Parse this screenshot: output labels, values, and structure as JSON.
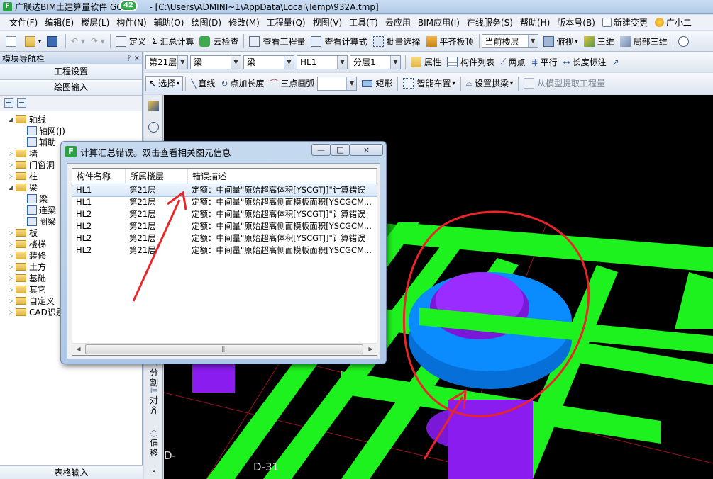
{
  "window": {
    "app_logo": "F",
    "title": "广联达BIM土建算量软件 GC",
    "path": " - [C:\\Users\\ADMINI~1\\AppData\\Local\\Temp\\932A.tmp]",
    "badge": "42"
  },
  "menu": [
    "文件(F)",
    "编辑(E)",
    "楼层(L)",
    "构件(N)",
    "辅助(O)",
    "绘图(D)",
    "修改(M)",
    "工程量(Q)",
    "视图(V)",
    "工具(T)",
    "云应用",
    "BIM应用(I)",
    "在线服务(S)",
    "帮助(H)",
    "版本号(B)"
  ],
  "menu_right": [
    "新建变更",
    "广小二"
  ],
  "toolbar1": {
    "define": "定义",
    "sum_calc": "汇总计算",
    "cloud_check": "云检查",
    "view_quantity": "查看工程量",
    "view_formula": "查看计算式",
    "batch_select": "批量选择",
    "align_slab": "平齐板顶",
    "floor_combo": "当前楼层",
    "top_view": "俯视",
    "three_d": "三维",
    "local_3d": "局部三维"
  },
  "toolbar2": {
    "floor": "第21层",
    "category": "梁",
    "type": "梁",
    "component": "HL1",
    "sublayer": "分层1",
    "properties": "属性",
    "component_list": "构件列表",
    "two_points": "两点",
    "parallel": "平行",
    "length_mark": "长度标注"
  },
  "toolbar3": {
    "select": "选择",
    "line": "直线",
    "point_length": "点加长度",
    "arc": "三点画弧",
    "rect": "矩形",
    "smart_place": "智能布置",
    "set_arch": "设置拱梁",
    "extract": "从模型提取工程量"
  },
  "nav": {
    "header": "模块导航栏",
    "pin": "ᚹ ×",
    "project_settings": "工程设置",
    "draw_input": "绘图输入",
    "table_input": "表格输入",
    "tree": [
      {
        "label": "轴线",
        "level": 0,
        "expanded": true
      },
      {
        "label": "轴网(J)",
        "level": 1
      },
      {
        "label": "辅助",
        "level": 1
      },
      {
        "label": "墙",
        "level": 0
      },
      {
        "label": "门窗洞",
        "level": 0
      },
      {
        "label": "柱",
        "level": 0
      },
      {
        "label": "梁",
        "level": 0,
        "expanded": true
      },
      {
        "label": "梁",
        "level": 1
      },
      {
        "label": "连梁",
        "level": 1
      },
      {
        "label": "圈梁",
        "level": 1
      },
      {
        "label": "板",
        "level": 0
      },
      {
        "label": "楼梯",
        "level": 0
      },
      {
        "label": "装修",
        "level": 0
      },
      {
        "label": "土方",
        "level": 0
      },
      {
        "label": "基础",
        "level": 0
      },
      {
        "label": "其它",
        "level": 0
      },
      {
        "label": "自定义",
        "level": 0
      },
      {
        "label": "CAD识别",
        "level": 0
      }
    ]
  },
  "side_tools": {
    "split": "分割",
    "split_prefix": "刂",
    "align": "对齐",
    "offset": "偏移"
  },
  "viewport": {
    "label_main": "D-31",
    "label_left": "D-"
  },
  "dialog": {
    "title": "计算汇总错误。双击查看相关图元信息",
    "min": "—",
    "max": "□",
    "close": "×",
    "columns": [
      "构件名称",
      "所属楼层",
      "错误描述"
    ],
    "rows": [
      {
        "name": "HL1",
        "floor": "第21层",
        "desc": "定额：中间量\"原始超高体积[YSCGTJ]\"计算错误"
      },
      {
        "name": "HL1",
        "floor": "第21层",
        "desc": "定额：中间量\"原始超高侧面模板面积[YSCGCM..."
      },
      {
        "name": "HL2",
        "floor": "第21层",
        "desc": "定额：中间量\"原始超高体积[YSCGTJ]\"计算错误"
      },
      {
        "name": "HL2",
        "floor": "第21层",
        "desc": "定额：中间量\"原始超高侧面模板面积[YSCGCM..."
      },
      {
        "name": "HL2",
        "floor": "第21层",
        "desc": "定额：中间量\"原始超高体积[YSCGTJ]\"计算错误"
      },
      {
        "name": "HL2",
        "floor": "第21层",
        "desc": "定额：中间量\"原始超高侧面模板面积[YSCGCM..."
      }
    ],
    "scroll_left": "◀",
    "scroll_right": "▶",
    "scroll_grip": "|||"
  },
  "colors": {
    "beam_green": "#1ef21e",
    "column_blue": "#0a8cff",
    "column_purple": "#8a1cf0",
    "annotation_red": "#e8262a"
  }
}
